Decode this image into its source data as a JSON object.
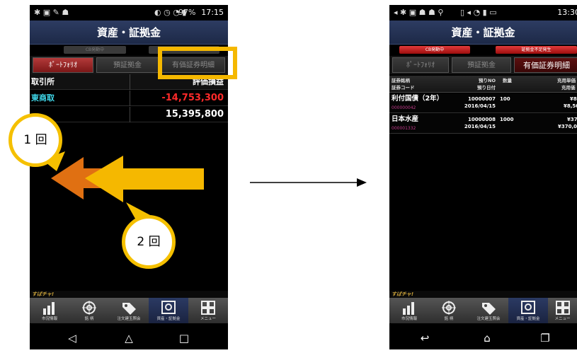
{
  "left_screen": {
    "status": {
      "battery": "97%",
      "time": "17:15"
    },
    "title": "資産・証拠金",
    "alert_chip": "CB発動中",
    "tabs": [
      "ﾎﾟｰﾄﾌｫﾘｵ",
      "預証拠金",
      "有価証券明細"
    ],
    "rows": [
      {
        "left": "取引所",
        "right": "評価損益"
      },
      {
        "left": "東商取",
        "right": "-14,753,300"
      },
      {
        "left": "",
        "right": "15,395,800"
      }
    ],
    "brand": "すばチャ!",
    "nav_items": [
      "市況情報",
      "銘 柄",
      "注文建玉照会",
      "資産・証拠金",
      "メニュー"
    ]
  },
  "right_screen": {
    "status": {
      "time": "13:30"
    },
    "title": "資産・証拠金",
    "alert_chips": [
      "CB発動中",
      "証拠金不足発生"
    ],
    "tabs": [
      "ﾎﾟｰﾄﾌｫﾘｵ",
      "預証拠金",
      "有価証券明細"
    ],
    "table": {
      "headers": {
        "name": "証券銘柄",
        "code": "証券コード",
        "no": "預りNO",
        "date": "預り日付",
        "qty": "数量",
        "unit": "充用単価",
        "amount": "充用価"
      },
      "rows": [
        {
          "name": "利付国債（2年）",
          "code": "000000042",
          "no": "10000007",
          "date": "2016/04/15",
          "qty": "100",
          "unit": "¥8",
          "amount": "¥8,50"
        },
        {
          "name": "日本水産",
          "code": "000001332",
          "no": "10000008",
          "date": "2016/04/15",
          "qty": "1000",
          "unit": "¥37",
          "amount": "¥370,00"
        }
      ]
    },
    "brand": "すばチャ!",
    "nav_items": [
      "市況情報",
      "銘 柄",
      "注文建玉照会",
      "資産・証拠金",
      "メニュー"
    ]
  },
  "annotations": {
    "balloon_1": "1 回",
    "balloon_2": "2 回",
    "colors": {
      "highlight": "#f5b800",
      "arrow_front": "#f5b800",
      "arrow_back": "#e07012"
    }
  }
}
